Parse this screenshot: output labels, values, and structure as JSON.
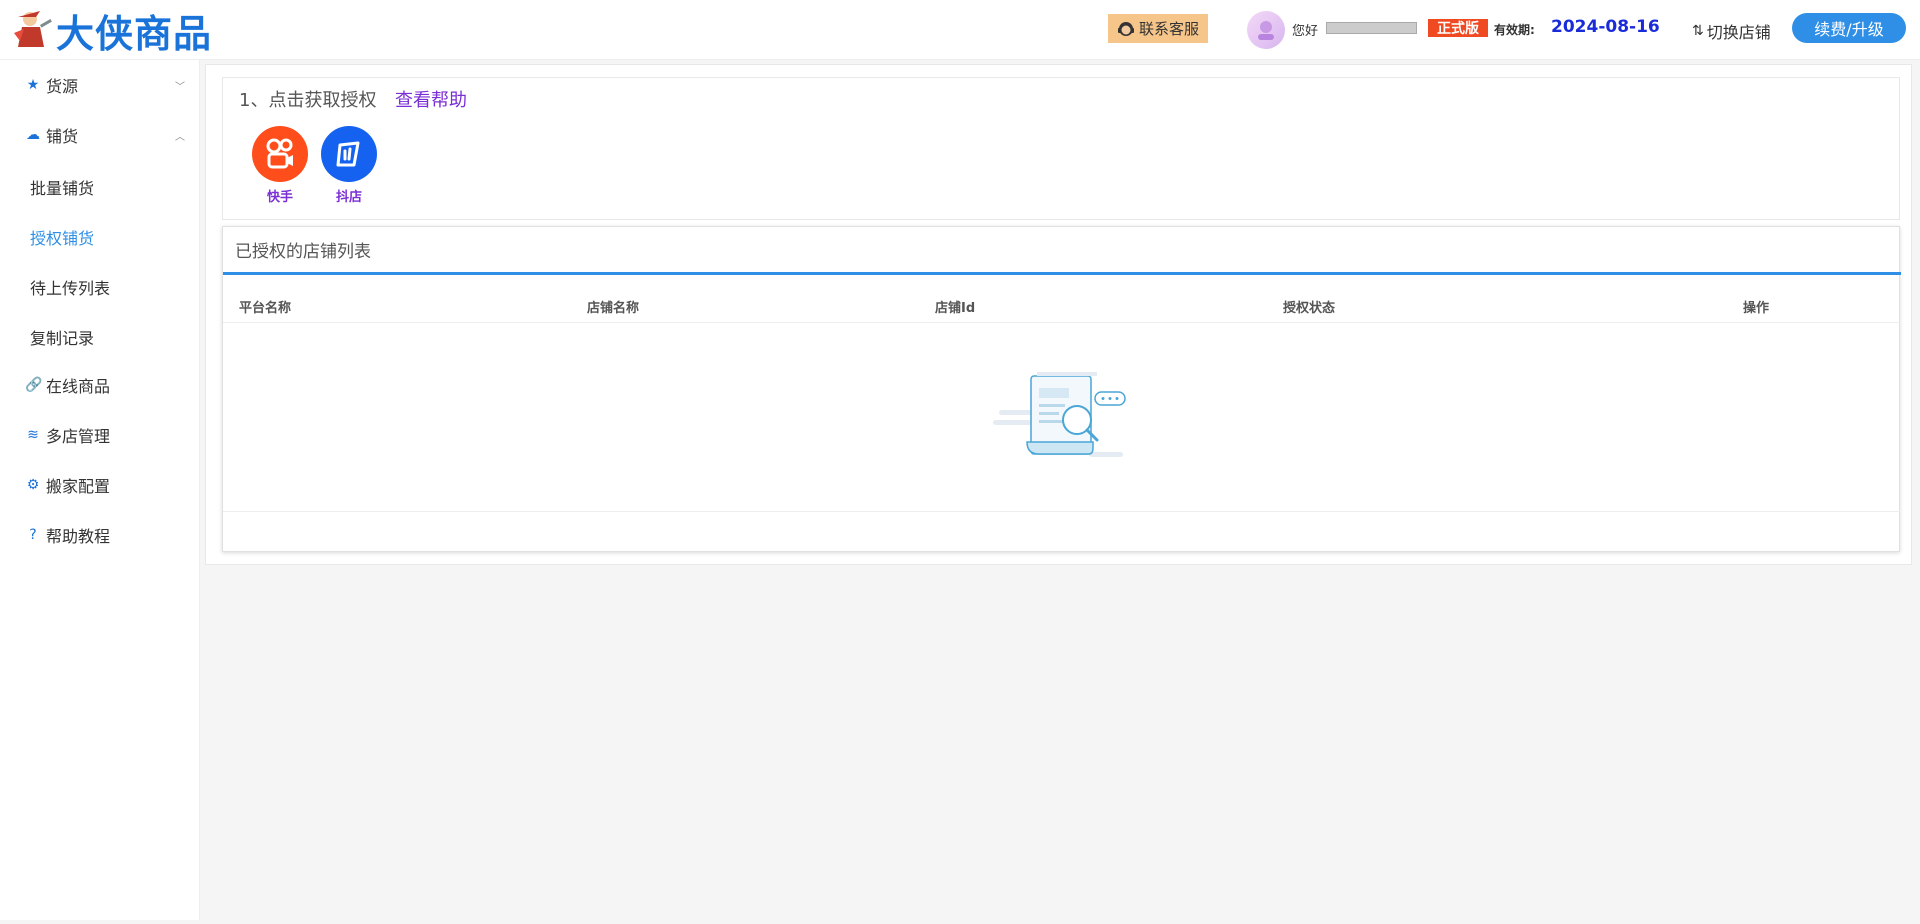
{
  "header": {
    "brand": "大侠商品",
    "support_label": "联系客服",
    "greeting": "您好",
    "edition": "正式版",
    "expiry_label": "有效期:",
    "expiry_date": "2024-08-16",
    "switch_shop": "切换店铺",
    "upgrade": "续费/升级"
  },
  "sidebar": {
    "items": [
      {
        "label": "货源",
        "icon": "star-icon"
      },
      {
        "label": "铺货",
        "icon": "cloud-upload-icon"
      },
      {
        "label": "批量铺货"
      },
      {
        "label": "授权铺货"
      },
      {
        "label": "待上传列表"
      },
      {
        "label": "复制记录"
      },
      {
        "label": "在线商品",
        "icon": "link-icon"
      },
      {
        "label": "多店管理",
        "icon": "layers-icon"
      },
      {
        "label": "搬家配置",
        "icon": "gear-icon"
      },
      {
        "label": "帮助教程",
        "icon": "question-icon"
      }
    ]
  },
  "auth": {
    "title": "1、点击获取授权",
    "help": "查看帮助",
    "platforms": [
      {
        "label": "快手",
        "icon": "kuaishou-icon",
        "color": "#ff4e1c"
      },
      {
        "label": "抖店",
        "icon": "doudian-icon",
        "color": "#1662f0"
      }
    ]
  },
  "shops": {
    "title": "已授权的店铺列表",
    "columns": [
      "平台名称",
      "店铺名称",
      "店铺Id",
      "授权状态",
      "操作"
    ]
  },
  "colors": {
    "accent": "#2f8fe6",
    "brand": "#1a73d9",
    "link": "#7b2fd6",
    "badge": "#f04a22"
  }
}
